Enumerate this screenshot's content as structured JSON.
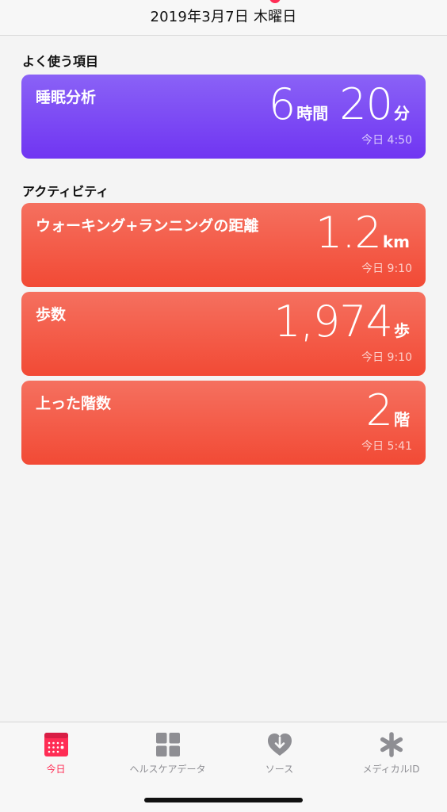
{
  "header": {
    "date": "2019年3月7日 木曜日"
  },
  "favorites": {
    "title": "よく使う項目",
    "sleep": {
      "label": "睡眠分析",
      "hours": "6",
      "hours_unit": "時間",
      "minutes": "20",
      "minutes_unit": "分",
      "time": "今日 4:50"
    }
  },
  "activity": {
    "title": "アクティビティ",
    "cards": [
      {
        "label": "ウォーキング+ランニングの距離",
        "value": "1.2",
        "unit": "km",
        "time": "今日 9:10"
      },
      {
        "label": "歩数",
        "value": "1,974",
        "unit": "歩",
        "time": "今日 9:10"
      },
      {
        "label": "上った階数",
        "value": "2",
        "unit": "階",
        "time": "今日 5:41"
      }
    ]
  },
  "tabs": [
    {
      "label": "今日",
      "icon": "calendar-icon"
    },
    {
      "label": "ヘルスケアデータ",
      "icon": "grid-icon"
    },
    {
      "label": "ソース",
      "icon": "heart-download-icon"
    },
    {
      "label": "メディカルID",
      "icon": "asterisk-icon"
    }
  ],
  "colors": {
    "accent": "#ff2d55",
    "sleep_card": "#7d4af4",
    "activity_card": "#f35a45",
    "tab_inactive": "#8e8e93"
  }
}
